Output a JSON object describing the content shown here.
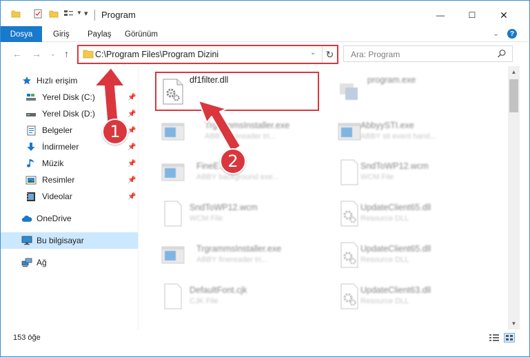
{
  "window": {
    "title": "Program",
    "controls": {
      "minimize": "—",
      "maximize": "☐",
      "close": "✕"
    }
  },
  "ribbon": {
    "tabs": [
      {
        "label": "Dosya",
        "active": true
      },
      {
        "label": "Giriş"
      },
      {
        "label": "Paylaş"
      },
      {
        "label": "Görünüm"
      }
    ],
    "help_label": "?"
  },
  "navigation": {
    "address": "C:\\Program Files\\Program Dizini",
    "search_placeholder": "Ara: Program"
  },
  "sidebar": {
    "items": [
      {
        "label": "Hızlı erişim",
        "icon": "star-icon"
      },
      {
        "label": "Yerel Disk (C:)",
        "icon": "drive-icon",
        "pinned": true
      },
      {
        "label": "Yerel Disk (D:)",
        "icon": "drive-icon",
        "pinned": true
      },
      {
        "label": "Belgeler",
        "icon": "documents-icon",
        "pinned": true
      },
      {
        "label": "İndirmeler",
        "icon": "download-icon",
        "pinned": true
      },
      {
        "label": "Müzik",
        "icon": "music-icon",
        "pinned": true
      },
      {
        "label": "Resimler",
        "icon": "pictures-icon",
        "pinned": true
      },
      {
        "label": "Videolar",
        "icon": "videos-icon",
        "pinned": true
      },
      {
        "label": "OneDrive",
        "icon": "cloud-icon"
      },
      {
        "label": "Bu bilgisayar",
        "icon": "computer-icon",
        "selected": true
      },
      {
        "label": "Ağ",
        "icon": "network-icon"
      }
    ]
  },
  "files": [
    {
      "name": "df1filter.dll",
      "desc": "",
      "icon": "dll-gear-icon",
      "highlighted": true
    },
    {
      "name": "program.exe",
      "desc": "",
      "icon": "exe-icon"
    },
    {
      "name": "TrgrammsInstaller.exe",
      "desc": "ABBY finereader tri...",
      "icon": "app-window-icon"
    },
    {
      "name": "AbbyySTI.exe",
      "desc": "ABBY sti event hand...",
      "icon": "app-window-icon"
    },
    {
      "name": "FineE...",
      "desc": "ABBY background exe...",
      "icon": "app-window-icon"
    },
    {
      "name": "SndToWP12.wcm",
      "desc": "WCM File",
      "icon": "blank-file-icon"
    },
    {
      "name": "SndToWP12.wcm",
      "desc": "WCM File",
      "icon": "blank-file-icon"
    },
    {
      "name": "UpdateClient65.dll",
      "desc": "Resource DLL",
      "icon": "dll-gear-icon"
    },
    {
      "name": "TrgrammsInstaller.exe",
      "desc": "ABBY finereader tri...",
      "icon": "app-window-icon"
    },
    {
      "name": "UpdateClient65.dll",
      "desc": "Resource DLL",
      "icon": "dll-gear-icon"
    },
    {
      "name": "DefaultFont.cjk",
      "desc": "CJK File",
      "icon": "blank-file-icon"
    },
    {
      "name": "UpdateClient63.dll",
      "desc": "Resource DLL",
      "icon": "dll-gear-icon"
    }
  ],
  "status": {
    "item_count": "153 öğe"
  },
  "annotations": [
    {
      "label": "1"
    },
    {
      "label": "2"
    }
  ],
  "colors": {
    "accent": "#1979ca",
    "highlight": "#d9363e",
    "selection": "#cce8ff"
  }
}
